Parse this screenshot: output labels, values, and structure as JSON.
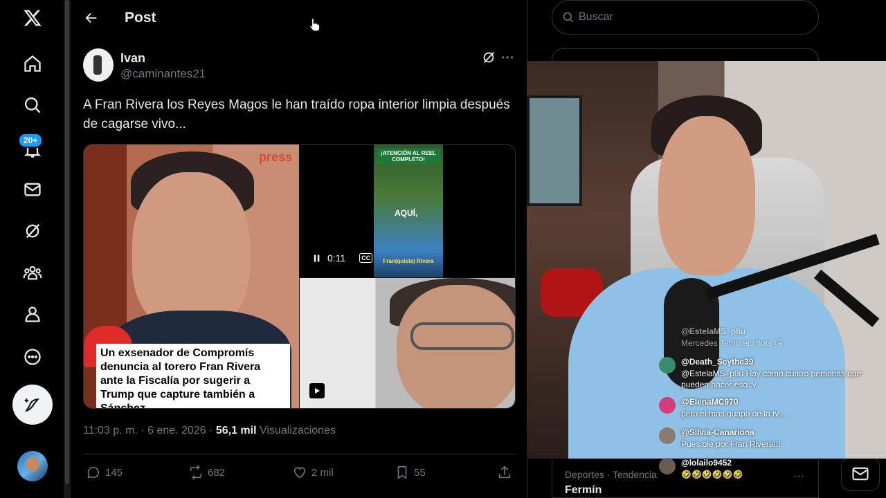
{
  "nav": {
    "notifications_badge": "20+"
  },
  "header": {
    "title": "Post"
  },
  "post": {
    "author_name": "Ivan",
    "author_handle": "@caminantes21",
    "text": "A Fran Rivera los Reyes Magos le han traído ropa interior limpia después de cagarse vivo...",
    "media": {
      "press_label": "press",
      "caption": "Un exsenador de Compromís denuncia al torero Fran Rivera ante la Fiscalía por sugerir a Trump que capture también a Sánchez",
      "video_top_text": "¡ATENCIÓN AL REEL COMPLETO!",
      "video_mid_text": "AQUÍ,",
      "video_bottom_text": "Fran(quista) Rivera",
      "video_time": "0:11",
      "cc_label": "CC"
    },
    "time": "11:03 p. m. · 6 ene. 2026 · ",
    "views_count": "56,1 mil",
    "views_label": " Visualizaciones",
    "replies": "145",
    "reposts": "682",
    "likes": "2 mil",
    "bookmarks": "55"
  },
  "sidebar": {
    "search_placeholder": "Buscar",
    "trend_category": "Deportes · Tendencia",
    "trend_name": "Fermín",
    "trend_more": "···"
  },
  "chat": {
    "messages": [
      {
        "user": "@EstelaMS_p8u",
        "text": "Mercedes Tamurejo hola 😘"
      },
      {
        "user": "@Death_Scythe39",
        "text": "@EstelaMS_p8u Hay como cuatro personas que pueden hacer eso :v"
      },
      {
        "user": "@ElenaMC970",
        "text": "pero el más guapo de la tv...."
      },
      {
        "user": "@Silvia-Canariona",
        "text": "Pues ole por Fran Rivera!!!"
      },
      {
        "user": "@lolailo9452",
        "text": "🤣🤣🤣🤣🤣🤣"
      }
    ]
  },
  "colors": {
    "accent": "#1d9bf0",
    "background": "#000000",
    "text_primary": "#e7e9ea",
    "text_secondary": "#71767b",
    "border": "#2f3336"
  }
}
